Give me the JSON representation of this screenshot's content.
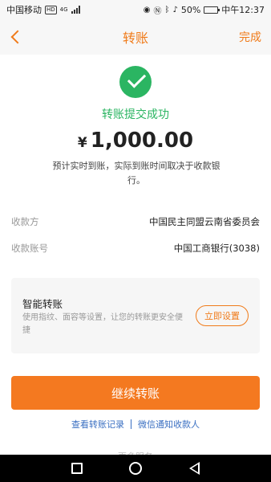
{
  "status_bar": {
    "carrier": "中国移动",
    "hd_badge": "HD",
    "network": "4G",
    "battery": "50%",
    "battery_level": 0.5,
    "time": "中午12:37"
  },
  "nav": {
    "title": "转账",
    "done_label": "完成"
  },
  "result": {
    "status_text": "转账提交成功",
    "currency_symbol": "¥",
    "amount": "1,000.00",
    "hint": "预计实时到账，实际到账时间取决于收款银行。"
  },
  "details": [
    {
      "label": "收款方",
      "value": "中国民主同盟云南省委员会"
    },
    {
      "label": "收款账号",
      "value": "中国工商银行(3038)"
    }
  ],
  "smart_transfer": {
    "title": "智能转账",
    "description": "使用指纹、面容等设置，让您的转账更安全便捷",
    "button_label": "立即设置"
  },
  "continue_button": "继续转账",
  "links": {
    "records": "查看转账记录",
    "notify": "微信通知收款人"
  },
  "partial_text": "更多服务",
  "colors": {
    "accent": "#f07b1a",
    "success": "#2bb562",
    "link": "#3a6fc2"
  }
}
